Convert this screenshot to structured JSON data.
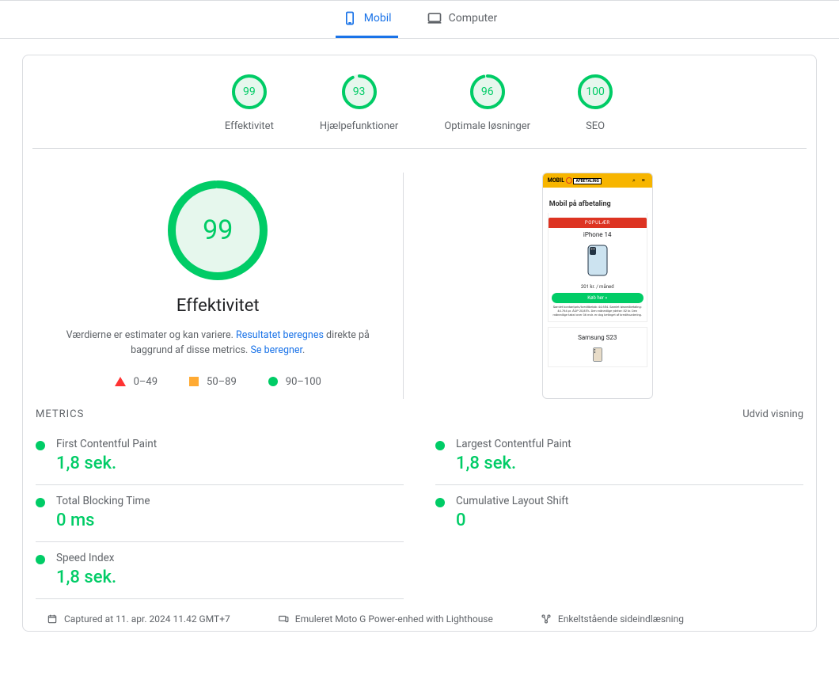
{
  "tabs": {
    "mobile": "Mobil",
    "computer": "Computer"
  },
  "gauges": [
    {
      "score": 99,
      "label": "Effektivitet",
      "frac": 0.99
    },
    {
      "score": 93,
      "label": "Hjælpefunktioner",
      "frac": 0.93
    },
    {
      "score": 96,
      "label": "Optimale løsninger",
      "frac": 0.96
    },
    {
      "score": 100,
      "label": "SEO",
      "frac": 1.0
    }
  ],
  "main": {
    "big_score": 99,
    "big_frac": 0.99,
    "title": "Effektivitet",
    "desc_pre": "Værdierne er estimater og kan variere. ",
    "desc_link1": "Resultatet beregnes",
    "desc_mid": " direkte på baggrund af disse metrics. ",
    "desc_link2": "Se beregner"
  },
  "legend": {
    "r1": "0–49",
    "r2": "50–89",
    "r3": "90–100"
  },
  "preview": {
    "brand_pre": "MOBIL",
    "brand_suf": "AFBETALING",
    "heading": "Mobil på afbetaling",
    "pop": "POPULÆR",
    "prod1": "iPhone 14",
    "price1": "201 kr. / måned",
    "btn": "Køb her »",
    "note": "Samlet kontantpris/kreditbeløb: 44.654. Samlet løsnedbetaling: 44.764 pr. ÅOP 20,85%. Den månedlige ydelse: 82 kr. Den månedlige takst over 36 mdr. er dog betinget af kreditvurdering.",
    "prod2": "Samsung S23"
  },
  "metrics": {
    "title": "METRICS",
    "expand": "Udvid visning",
    "items": [
      {
        "name": "First Contentful Paint",
        "value": "1,8 sek."
      },
      {
        "name": "Largest Contentful Paint",
        "value": "1,8 sek."
      },
      {
        "name": "Total Blocking Time",
        "value": "0 ms"
      },
      {
        "name": "Cumulative Layout Shift",
        "value": "0"
      },
      {
        "name": "Speed Index",
        "value": "1,8 sek."
      }
    ]
  },
  "footer": {
    "captured": "Captured at 11. apr. 2024 11.42 GMT+7",
    "emulated": "Emuleret Moto G Power-enhed with Lighthouse",
    "loading": "Enkeltstående sideindlæsning"
  }
}
